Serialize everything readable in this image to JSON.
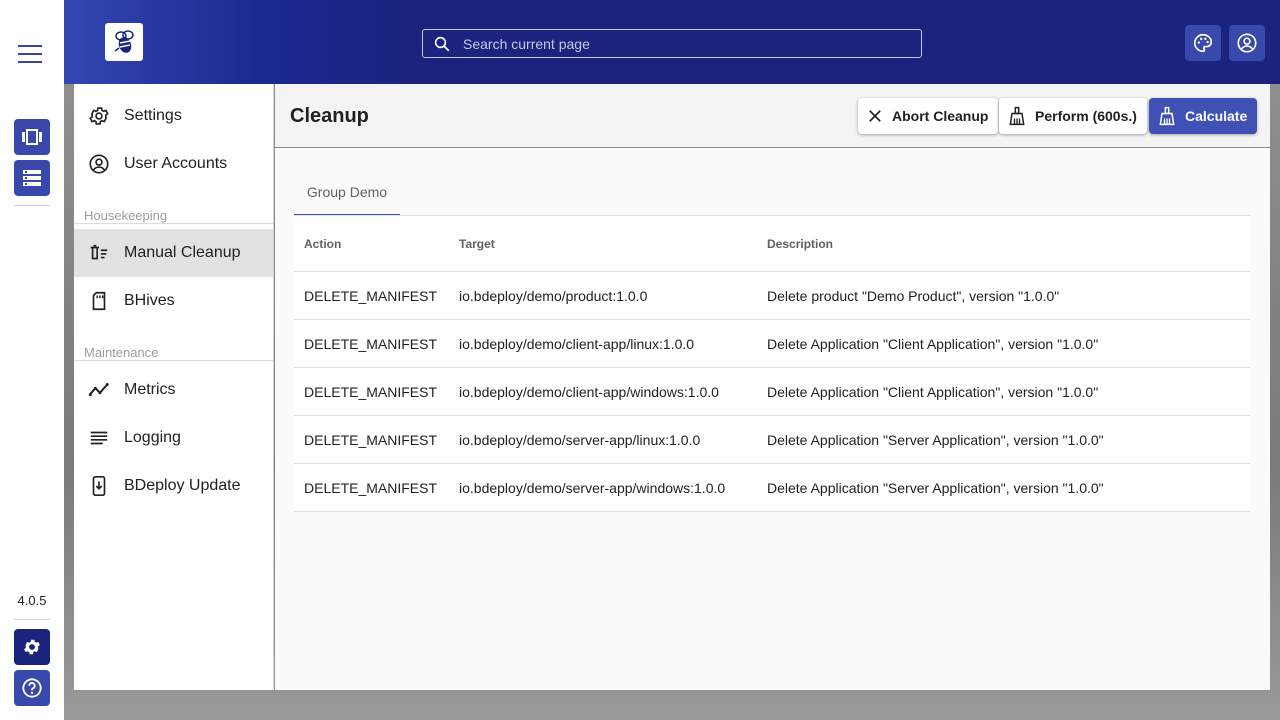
{
  "app": {
    "version": "4.0.5",
    "search_placeholder": "Search current page"
  },
  "sidebar": {
    "items": [
      {
        "label": "Settings",
        "icon": "gear-icon"
      },
      {
        "label": "User Accounts",
        "icon": "account-circle-icon"
      },
      {
        "label": "Manual Cleanup",
        "icon": "delete-sweep-icon",
        "active": true
      },
      {
        "label": "BHives",
        "icon": "sd-card-icon"
      },
      {
        "label": "Metrics",
        "icon": "timeline-icon"
      },
      {
        "label": "Logging",
        "icon": "lines-icon"
      },
      {
        "label": "BDeploy Update",
        "icon": "system-update-icon"
      }
    ],
    "sections": {
      "housekeeping": "Housekeeping",
      "maintenance": "Maintenance"
    }
  },
  "main": {
    "title": "Cleanup",
    "buttons": {
      "abort": "Abort Cleanup",
      "perform": "Perform (600s.)",
      "calculate": "Calculate"
    },
    "tab": "Group Demo",
    "table": {
      "columns": [
        "Action",
        "Target",
        "Description"
      ],
      "rows": [
        [
          "DELETE_MANIFEST",
          "io.bdeploy/demo/product:1.0.0",
          "Delete product \"Demo Product\", version \"1.0.0\""
        ],
        [
          "DELETE_MANIFEST",
          "io.bdeploy/demo/client-app/linux:1.0.0",
          "Delete Application \"Client Application\", version \"1.0.0\""
        ],
        [
          "DELETE_MANIFEST",
          "io.bdeploy/demo/client-app/windows:1.0.0",
          "Delete Application \"Client Application\", version \"1.0.0\""
        ],
        [
          "DELETE_MANIFEST",
          "io.bdeploy/demo/server-app/linux:1.0.0",
          "Delete Application \"Server Application\", version \"1.0.0\""
        ],
        [
          "DELETE_MANIFEST",
          "io.bdeploy/demo/server-app/windows:1.0.0",
          "Delete Application \"Server Application\", version \"1.0.0\""
        ]
      ]
    }
  },
  "colors": {
    "header": "#1a237e",
    "accent": "#3f51b5",
    "rail_button": "#3949ab"
  }
}
